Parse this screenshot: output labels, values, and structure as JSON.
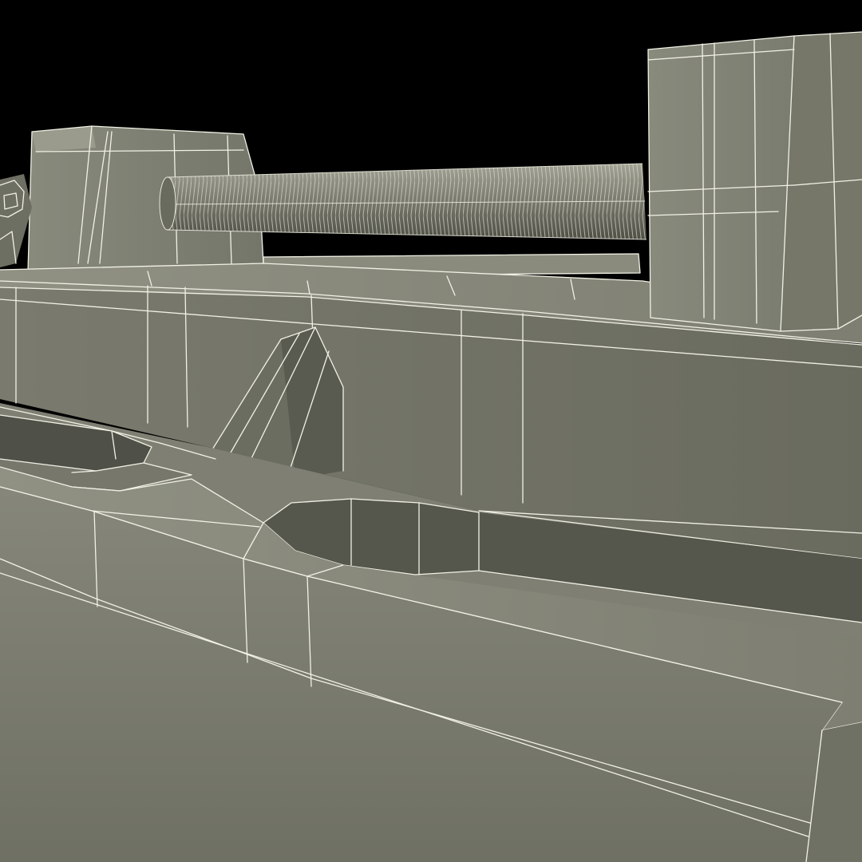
{
  "scene": {
    "subject": "drill-press-vise-wireframe-render",
    "icon": "vise-model-icon",
    "colors": {
      "background": "#000000",
      "surface_light": "#8c8d7f",
      "surface_mid": "#7b7c6f",
      "surface_dark": "#5c5d52",
      "surface_shadow": "#43443b",
      "wireframe": "#f2f1e6"
    }
  }
}
